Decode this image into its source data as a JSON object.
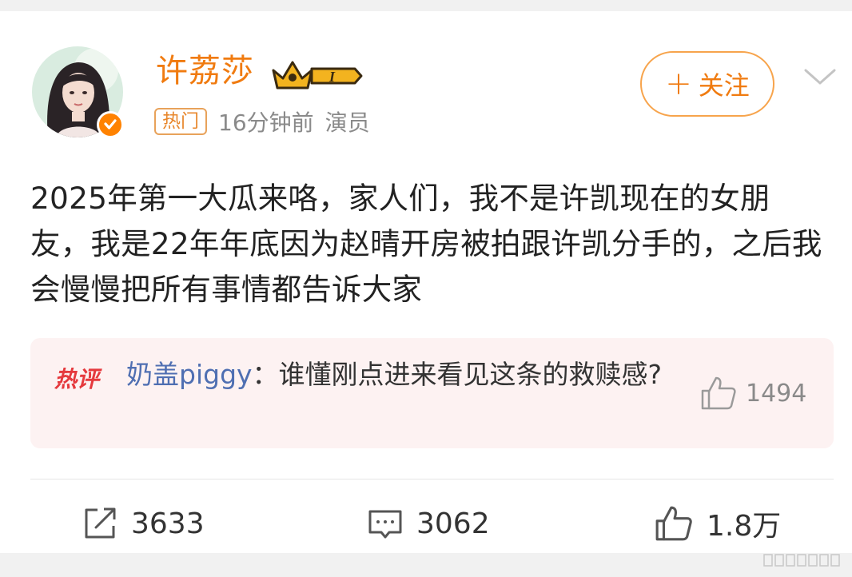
{
  "post": {
    "username": "许荔莎",
    "badge_level": "I",
    "hot_tag": "热门",
    "time": "16分钟前",
    "role": "演员",
    "follow_label": "关注",
    "content": "2025年第一大瓜来咯，家人们，我不是许凯现在的女朋友，我是22年年底因为赵晴开房被拍跟许凯分手的，之后我会慢慢把所有事情都告诉大家"
  },
  "hot_comment": {
    "logo_text": "热评",
    "user": "奶盖piggy",
    "separator": "：",
    "text": "谁懂刚点进来看见这条的救赎感?",
    "likes": "1494"
  },
  "actions": {
    "repost_count": "3633",
    "comment_count": "3062",
    "like_count": "1.8万"
  },
  "colors": {
    "brand_orange": "#f07b10",
    "user_link_blue": "#4f6fb2",
    "hot_comment_bg": "#fdf2f2"
  }
}
